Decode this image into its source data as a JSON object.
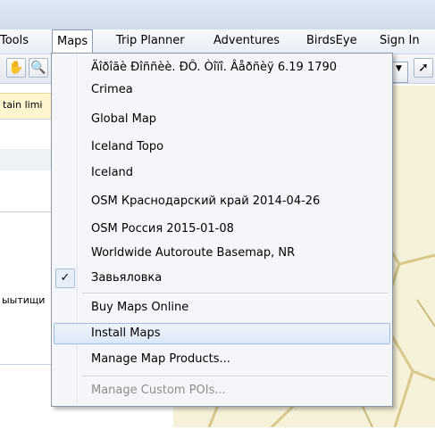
{
  "menubar": {
    "items": [
      "Tools",
      "Maps",
      "Trip Planner",
      "Adventures",
      "BirdsEye",
      "Sign In"
    ],
    "active": "Maps"
  },
  "toolbar": {
    "tools": [
      {
        "icon": "pan-hand-icon",
        "glyph": "✋"
      },
      {
        "icon": "zoom-magnifier-icon",
        "glyph": "🔍"
      }
    ],
    "right_icon": {
      "icon": "route-tool-icon",
      "glyph": "➚"
    }
  },
  "warning": {
    "text": "tain limi"
  },
  "left_panel": {
    "label": "ыытищи"
  },
  "maps_menu": {
    "items": [
      {
        "label": "Äîðîãè Ðîññèè. ÐÔ. Òîïî. Âåðñèÿ 6.19 1790",
        "checked": false,
        "hover": false,
        "disabled": false
      },
      {
        "label": "Crimea",
        "checked": false,
        "hover": false,
        "disabled": false
      },
      {
        "label": "Global Map",
        "checked": false,
        "hover": false,
        "disabled": false
      },
      {
        "label": "Iceland Topo",
        "checked": false,
        "hover": false,
        "disabled": false
      },
      {
        "label": "Iceland",
        "checked": false,
        "hover": false,
        "disabled": false
      },
      {
        "label": "OSM Краснодарский край 2014-04-26",
        "checked": false,
        "hover": false,
        "disabled": false
      },
      {
        "label": "OSM Россия 2015-01-08",
        "checked": false,
        "hover": false,
        "disabled": false
      },
      {
        "label": "Worldwide Autoroute Basemap, NR",
        "checked": false,
        "hover": false,
        "disabled": false
      },
      {
        "label": "Завьяловка",
        "checked": true,
        "hover": false,
        "disabled": false
      },
      {
        "label": "Buy Maps Online",
        "checked": false,
        "hover": false,
        "disabled": false
      },
      {
        "label": "Install Maps",
        "checked": false,
        "hover": true,
        "disabled": false
      },
      {
        "label": "Manage Map Products...",
        "checked": false,
        "hover": false,
        "disabled": false
      },
      {
        "label": "Manage Custom POIs...",
        "checked": false,
        "hover": false,
        "disabled": true
      }
    ],
    "check_glyph": "✓"
  },
  "colors": {
    "menu_background": "#f4f6f9",
    "hover_border": "#9fbce2",
    "disabled_text": "#8d8d8d",
    "map_background": "#f6f1d9"
  }
}
